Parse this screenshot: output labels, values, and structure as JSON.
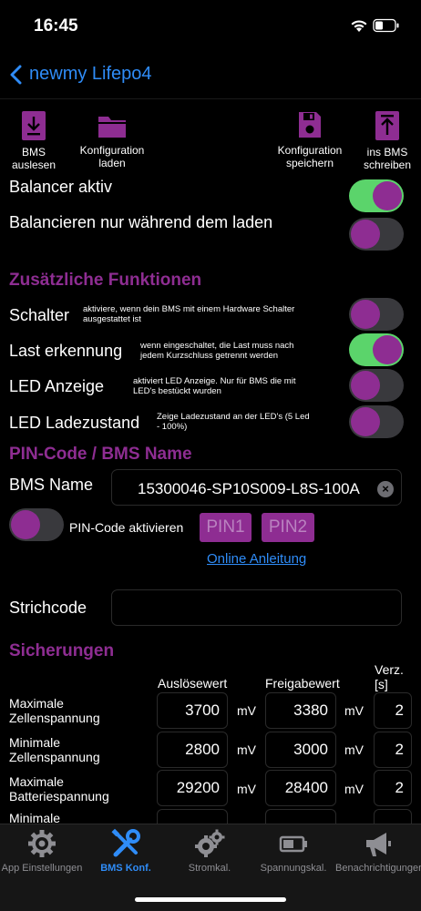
{
  "status": {
    "time": "16:45"
  },
  "nav": {
    "back_label": "newmy Lifepo4"
  },
  "toolbar": {
    "read": "BMS\nauslesen",
    "load": "Konfiguration\nladen",
    "save": "Konfiguration\nspeichern",
    "write": "ins BMS\nschreiben"
  },
  "settings": {
    "balancer": {
      "label": "Balancer aktiv",
      "on": true
    },
    "balance_charge": {
      "label": "Balancieren nur während dem laden",
      "on": false
    }
  },
  "extra": {
    "title": "Zusätzliche Funktionen",
    "schalter": {
      "label": "Schalter",
      "hint": "aktiviere, wenn dein BMS mit einem Hardware Schalter\nausgestattet ist",
      "on": false
    },
    "last": {
      "label": "Last erkennung",
      "hint": "wenn eingeschaltet, die Last muss nach\njedem Kurzschluss getrennt werden",
      "on": true
    },
    "led": {
      "label": "LED Anzeige",
      "hint": "aktiviert LED Anzeige. Nur für BMS die mit\nLED's bestückt wurden",
      "on": false
    },
    "led_state": {
      "label": "LED Ladezustand",
      "hint": "Zeige Ladezustand an der LED's (5 Led\n- 100%)",
      "on": false
    }
  },
  "pin": {
    "title": "PIN-Code / BMS Name",
    "bms_name_label": "BMS Name",
    "bms_name_value": "15300046-SP10S009-L8S-100A",
    "pin_toggle_label": "PIN-Code aktivieren",
    "pin_on": false,
    "pin1": "PIN1",
    "pin2": "PIN2",
    "online": "Online Anleitung",
    "strichcode_label": "Strichcode",
    "strichcode_value": ""
  },
  "sicherungen": {
    "title": "Sicherungen",
    "col_trigger": "Auslösewert",
    "col_release": "Freigabewert",
    "col_delay": "Verz.\n[s]",
    "rows": [
      {
        "name": "Maximale\nZellenspannung",
        "trigger": "3700",
        "unit1": "mV",
        "release": "3380",
        "unit2": "mV",
        "delay": "2"
      },
      {
        "name": "Minimale\nZellenspannung",
        "trigger": "2800",
        "unit1": "mV",
        "release": "3000",
        "unit2": "mV",
        "delay": "2"
      },
      {
        "name": "Maximale\nBatteriespannung",
        "trigger": "29200",
        "unit1": "mV",
        "release": "28400",
        "unit2": "mV",
        "delay": "2"
      },
      {
        "name": "Minimale",
        "trigger": "",
        "unit1": "",
        "release": "",
        "unit2": "",
        "delay": ""
      }
    ]
  },
  "tabs": {
    "app": "App Einstellungen",
    "bms": "BMS Konf.",
    "strom": "Stromkal.",
    "spannung": "Spannungskal.",
    "notify": "Benachrichtigungen"
  },
  "colors": {
    "accent": "#8e2d92",
    "link": "#2f8cf7",
    "toggle_on": "#5bd46b"
  }
}
